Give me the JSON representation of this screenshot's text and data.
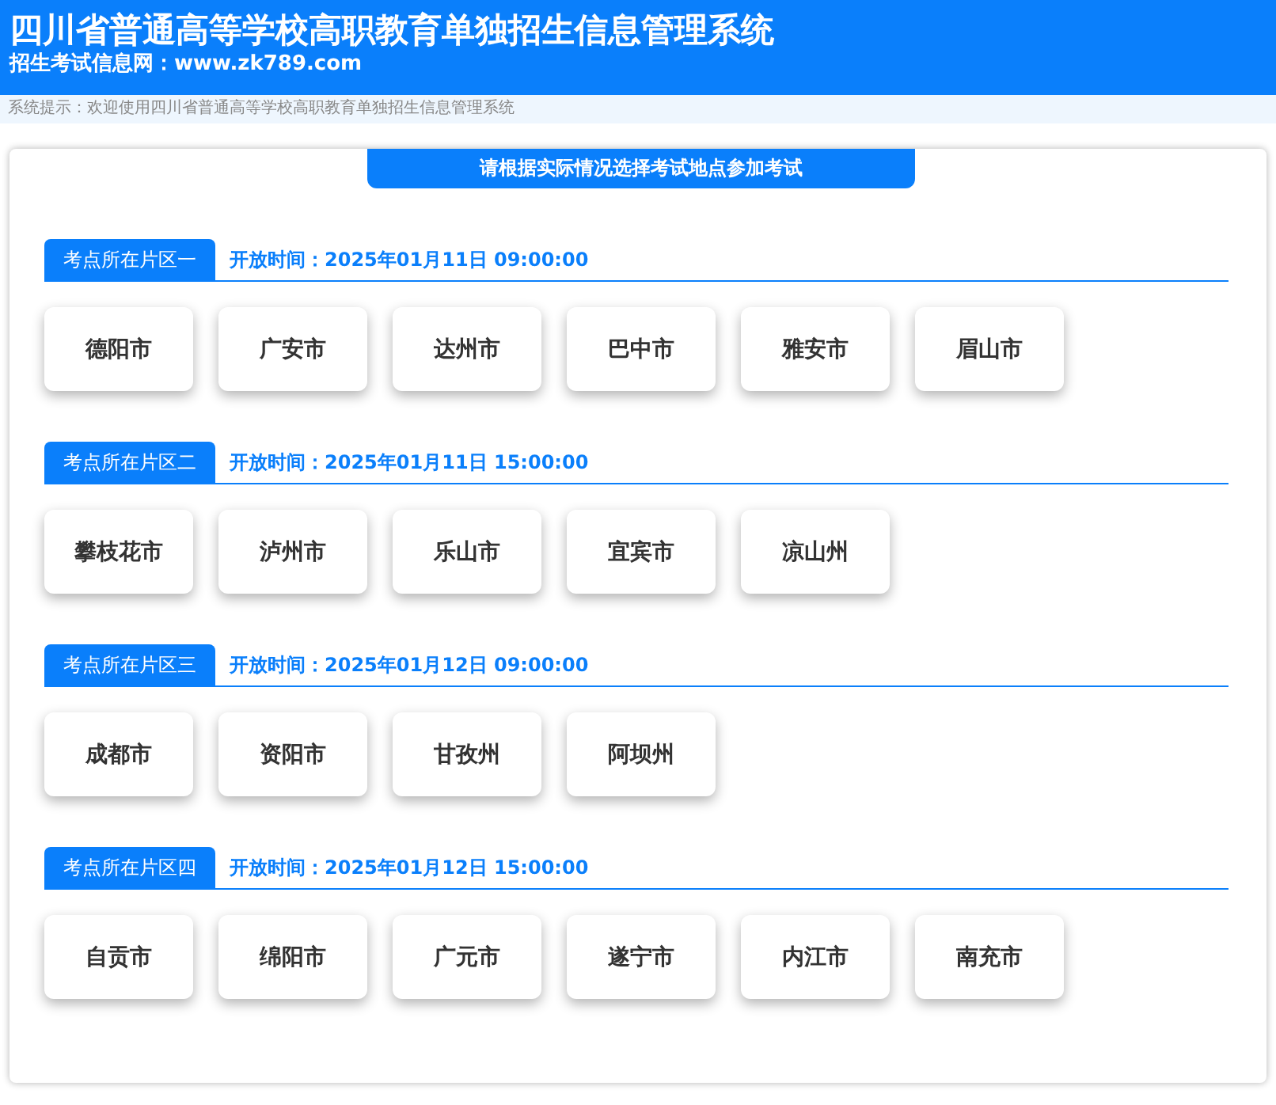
{
  "header": {
    "title": "四川省普通高等学校高职教育单独招生信息管理系统",
    "subtitle": "招生考试信息网：www.zk789.com"
  },
  "notice": "系统提示：欢迎使用四川省普通高等学校高职教育单独招生信息管理系统",
  "banner": "请根据实际情况选择考试地点参加考试",
  "regions": [
    {
      "label": "考点所在片区一",
      "time": "开放时间：2025年01月11日 09:00:00",
      "cities": [
        "德阳市",
        "广安市",
        "达州市",
        "巴中市",
        "雅安市",
        "眉山市"
      ]
    },
    {
      "label": "考点所在片区二",
      "time": "开放时间：2025年01月11日 15:00:00",
      "cities": [
        "攀枝花市",
        "泸州市",
        "乐山市",
        "宜宾市",
        "凉山州"
      ]
    },
    {
      "label": "考点所在片区三",
      "time": "开放时间：2025年01月12日 09:00:00",
      "cities": [
        "成都市",
        "资阳市",
        "甘孜州",
        "阿坝州"
      ]
    },
    {
      "label": "考点所在片区四",
      "time": "开放时间：2025年01月12日 15:00:00",
      "cities": [
        "自贡市",
        "绵阳市",
        "广元市",
        "遂宁市",
        "内江市",
        "南充市"
      ]
    }
  ]
}
